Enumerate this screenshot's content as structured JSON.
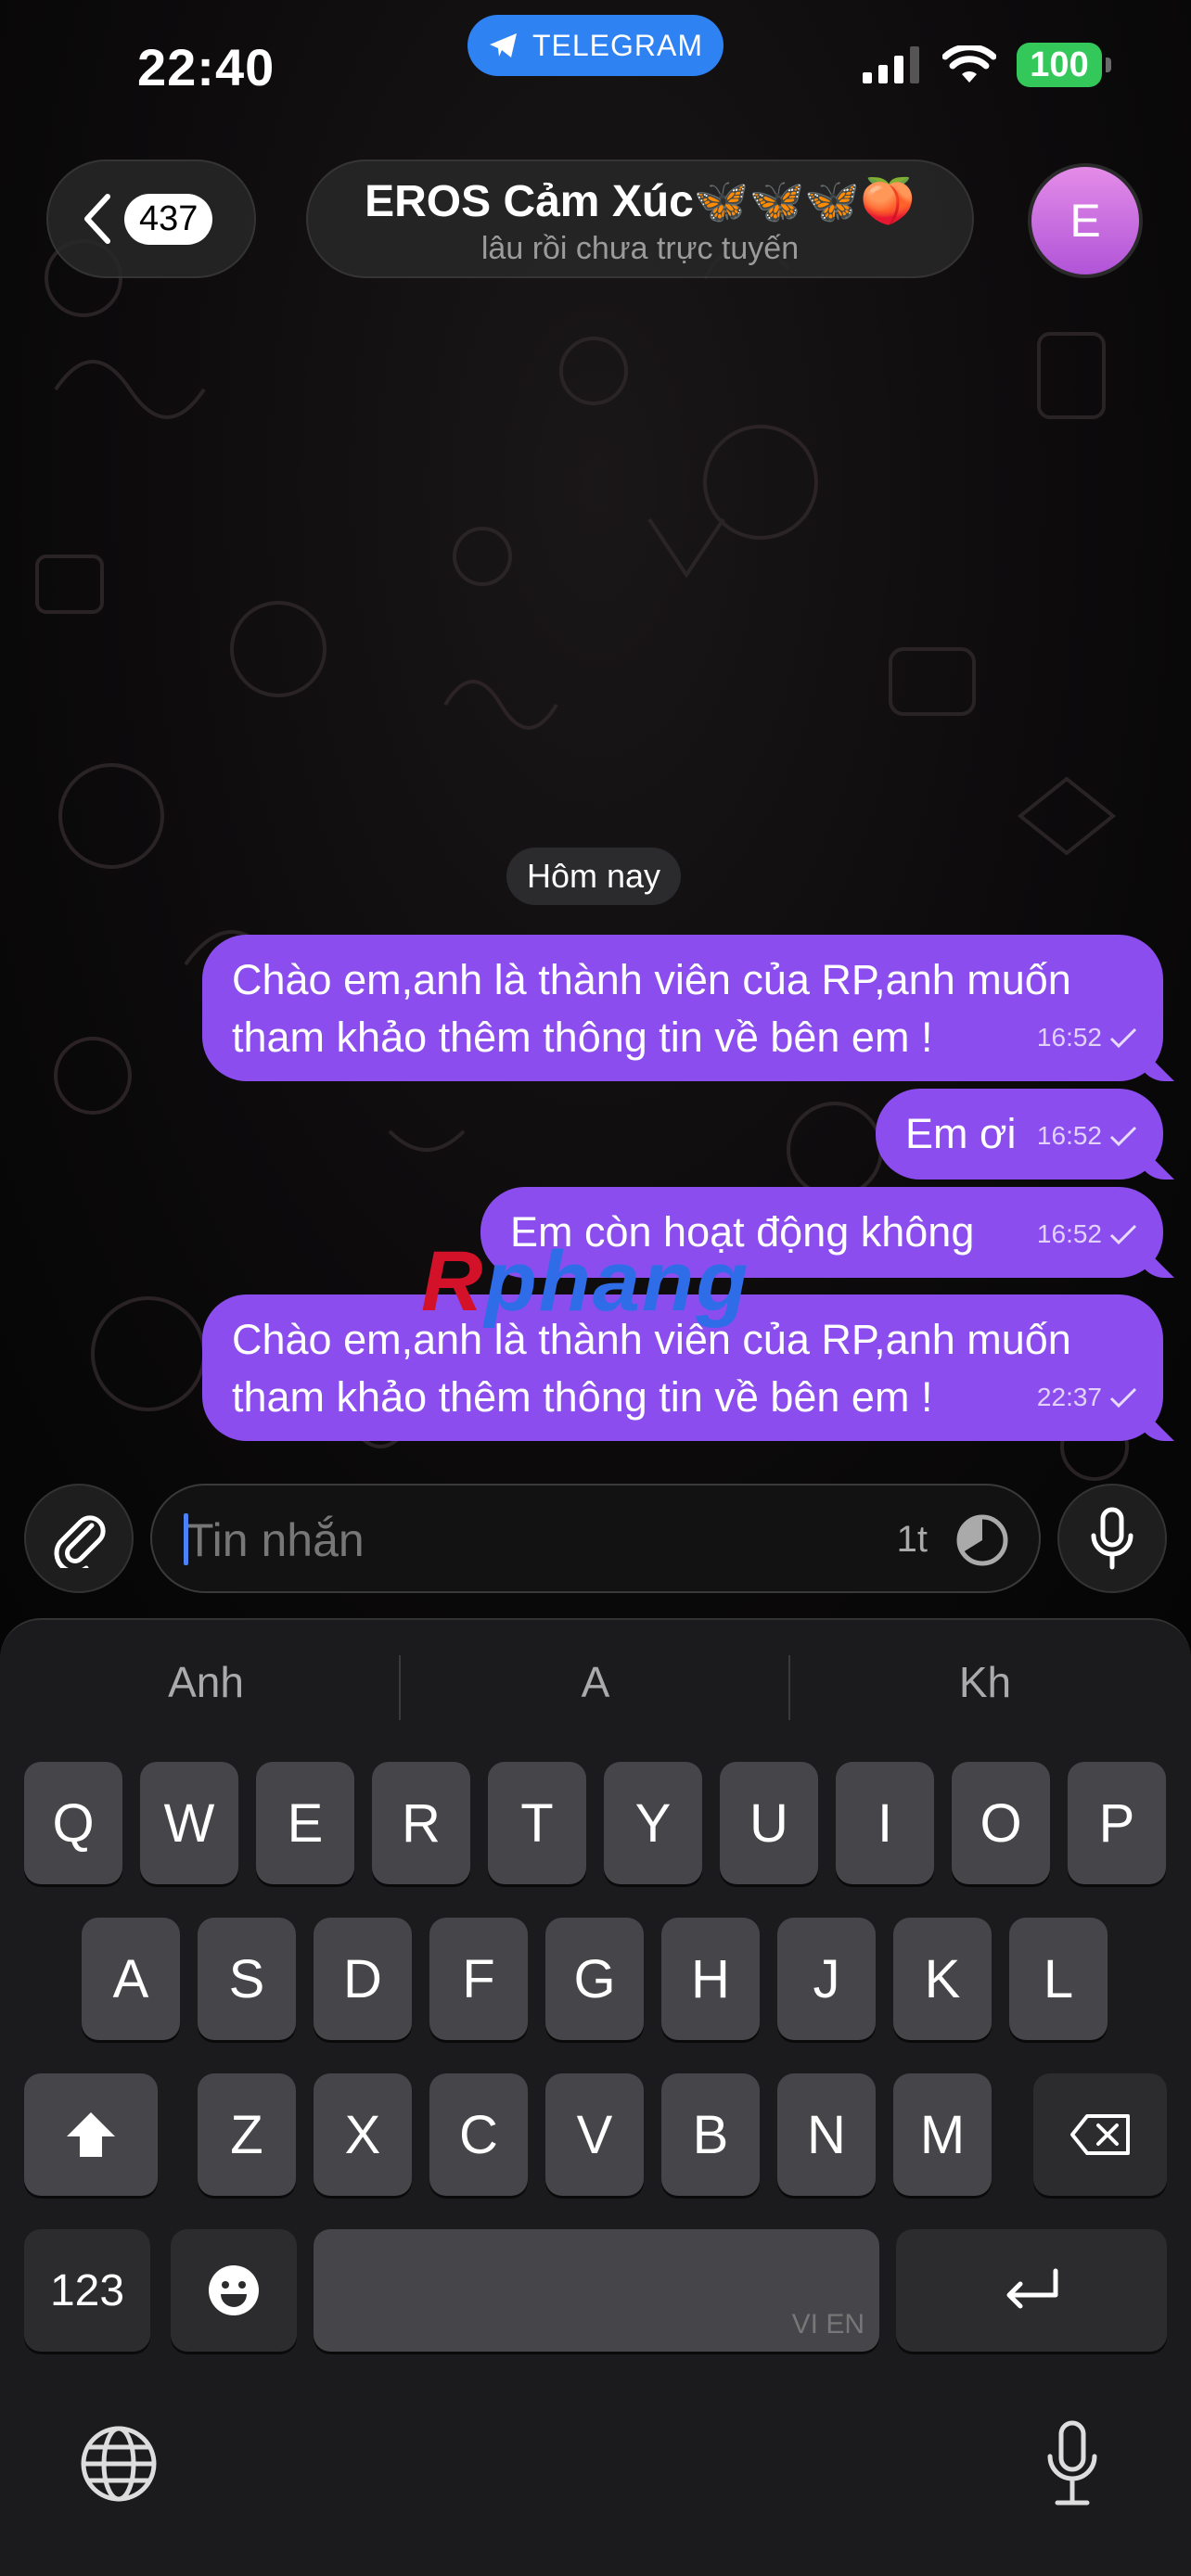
{
  "status_bar": {
    "time": "22:40",
    "app_pill": "TELEGRAM",
    "battery": "100"
  },
  "header": {
    "back_count": "437",
    "title": "EROS Cảm Xúc🦋🦋🦋🍑",
    "subtitle": "lâu rồi chưa trực tuyến",
    "avatar_letter": "E"
  },
  "date_chip": "Hôm nay",
  "messages": [
    {
      "line1": "Chào em,anh là thành viên của RP,anh muốn",
      "line2": "tham khảo thêm thông tin về bên em !",
      "time": "16:52"
    },
    {
      "line1": "Em ơi",
      "time": "16:52"
    },
    {
      "line1": "Em còn hoạt động không",
      "time": "16:52"
    },
    {
      "line1": "Chào em,anh là thành viên của RP,anh muốn",
      "line2": "tham khảo thêm thông tin về bên em !",
      "time": "22:37"
    }
  ],
  "watermark": {
    "first": "R",
    "rest": "phang"
  },
  "composer": {
    "placeholder": "Tin nhắn",
    "timer_label": "1t"
  },
  "keyboard": {
    "suggestions": [
      "Anh",
      "A",
      "Kh"
    ],
    "row1": [
      "Q",
      "W",
      "E",
      "R",
      "T",
      "Y",
      "U",
      "I",
      "O",
      "P"
    ],
    "row2": [
      "A",
      "S",
      "D",
      "F",
      "G",
      "H",
      "J",
      "K",
      "L"
    ],
    "row3": [
      "Z",
      "X",
      "C",
      "V",
      "B",
      "N",
      "M"
    ],
    "numbers_key": "123",
    "space_hint": "VI EN"
  },
  "colors": {
    "bubble": "#8b4dee",
    "accent": "#2f82f2",
    "battery": "#34c759"
  }
}
